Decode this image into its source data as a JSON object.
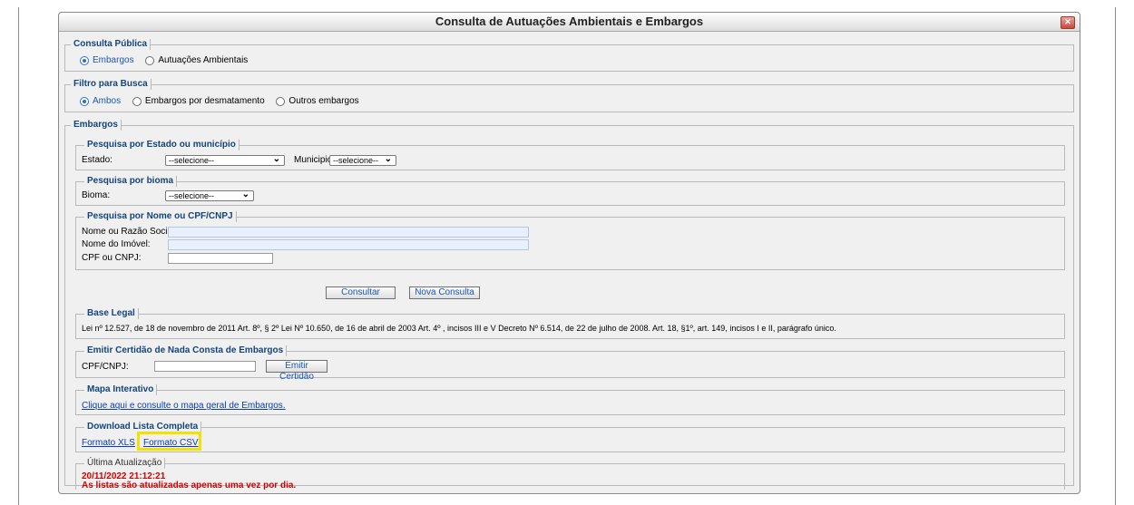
{
  "window": {
    "title": "Consulta de Autuações Ambientais e Embargos",
    "close_label": "✕"
  },
  "consulta_publica": {
    "legend": "Consulta Pública",
    "options": [
      {
        "label": "Embargos",
        "selected": true
      },
      {
        "label": "Autuações Ambientais",
        "selected": false
      }
    ]
  },
  "filtro": {
    "legend": "Filtro para Busca",
    "options": [
      {
        "label": "Ambos",
        "selected": true
      },
      {
        "label": "Embargos por desmatamento",
        "selected": false
      },
      {
        "label": "Outros embargos",
        "selected": false
      }
    ]
  },
  "embargos": {
    "legend": "Embargos",
    "estado_section": {
      "legend": "Pesquisa por Estado ou município",
      "estado_label": "Estado:",
      "estado_value": "--selecione--",
      "municipio_label": "Municipio:",
      "municipio_value": "--selecione--"
    },
    "bioma_section": {
      "legend": "Pesquisa por bioma",
      "bioma_label": "Bioma:",
      "bioma_value": "--selecione--"
    },
    "nome_section": {
      "legend": "Pesquisa por Nome ou CPF/CNPJ",
      "nome_label": "Nome ou Razão Social:",
      "imovel_label": "Nome do Imóvel:",
      "cpf_label": "CPF ou CNPJ:",
      "nome_value": "",
      "imovel_value": "",
      "cpf_value": ""
    },
    "consultar_label": "Consultar",
    "nova_consulta_label": "Nova Consulta",
    "base_legal": {
      "legend": "Base Legal",
      "text": "Lei nº 12.527, de 18 de novembro de 2011 Art. 8º, § 2º Lei Nº 10.650, de 16 de abril de 2003 Art. 4º , incisos III e V Decreto Nº 6.514, de 22 de julho de 2008. Art. 18, §1º, art. 149, incisos I e II, parágrafo único."
    },
    "certidao": {
      "legend": "Emitir Certidão de Nada Consta de Embargos",
      "cpf_label": "CPF/CNPJ:",
      "cpf_value": "",
      "button_label": "Emitir Certidão"
    },
    "mapa": {
      "legend": "Mapa Interativo",
      "link": "Clique aqui e consulte o mapa geral de Embargos."
    },
    "download": {
      "legend": "Download Lista Completa",
      "xls": "Formato XLS",
      "csv": "Formato CSV",
      "highlight_color": "#f4e100"
    },
    "atualizacao": {
      "legend": "Última Atualização",
      "datetime": "20/11/2022 21:12:21",
      "note": "As listas são atualizadas apenas uma vez por dia."
    }
  }
}
